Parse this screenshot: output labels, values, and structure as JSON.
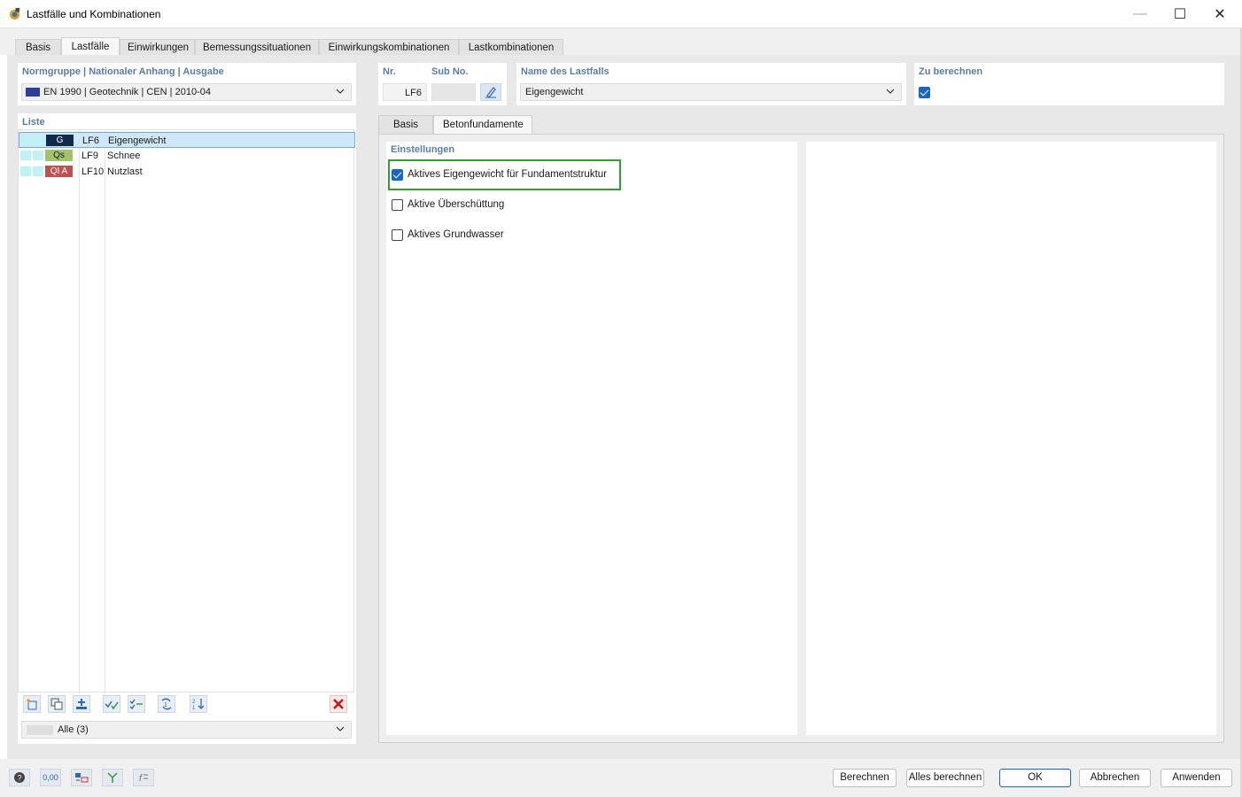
{
  "window": {
    "title": "Lastfälle und Kombinationen",
    "minimize": "—",
    "maximize": "☐",
    "close": "✕"
  },
  "tabs": [
    {
      "label": "Basis"
    },
    {
      "label": "Lastfälle"
    },
    {
      "label": "Einwirkungen"
    },
    {
      "label": "Bemessungssituationen"
    },
    {
      "label": "Einwirkungskombinationen"
    },
    {
      "label": "Lastkombinationen"
    }
  ],
  "norm": {
    "label": "Normgruppe | Nationaler Anhang | Ausgabe",
    "value": "EN 1990 | Geotechnik | CEN | 2010-04"
  },
  "list": {
    "label": "Liste",
    "rows": [
      {
        "tag": "G",
        "no": "LF6",
        "name": "Eigengewicht",
        "tag_bg": "#0f2a4a",
        "tag_fg": "#ffffff"
      },
      {
        "tag": "Qs",
        "no": "LF9",
        "name": "Schnee",
        "tag_bg": "#a2c36a",
        "tag_fg": "#1a1a1a"
      },
      {
        "tag": "QI A",
        "no": "LF10",
        "name": "Nutzlast",
        "tag_bg": "#c0504d",
        "tag_fg": "#ffffff"
      }
    ],
    "filter": "Alle (3)"
  },
  "toolbar_icons": [
    "new-item-icon",
    "copy-item-icon",
    "import-icon",
    "check-all-icon",
    "check-toggle-icon",
    "renumber-icon",
    "sort-icon",
    "delete-icon"
  ],
  "header": {
    "nr_label": "Nr.",
    "nr_value": "LF6",
    "subno_label": "Sub No.",
    "subno_value": "",
    "name_label": "Name des Lastfalls",
    "name_value": "Eigengewicht",
    "calc_label": "Zu berechnen",
    "calc_checked": true
  },
  "subtabs": [
    {
      "label": "Basis"
    },
    {
      "label": "Betonfundamente"
    }
  ],
  "settings": {
    "label": "Einstellungen",
    "options": [
      {
        "label": "Aktives Eigengewicht für Fundamentstruktur",
        "checked": true
      },
      {
        "label": "Aktive Überschüttung",
        "checked": false
      },
      {
        "label": "Aktives Grundwasser",
        "checked": false
      }
    ]
  },
  "footer": {
    "icons": [
      "help-icon",
      "units-icon",
      "display-icon",
      "model-icon",
      "formula-icon"
    ],
    "buttons": {
      "calculate": "Berechnen",
      "calculate_all": "Alles berechnen",
      "ok": "OK",
      "cancel": "Abbrechen",
      "apply": "Anwenden"
    },
    "units_text": "0,00"
  },
  "colors": {
    "accent": "#1865c4",
    "label_blue": "#5a7ca5",
    "highlight_green": "#2ea02e"
  }
}
